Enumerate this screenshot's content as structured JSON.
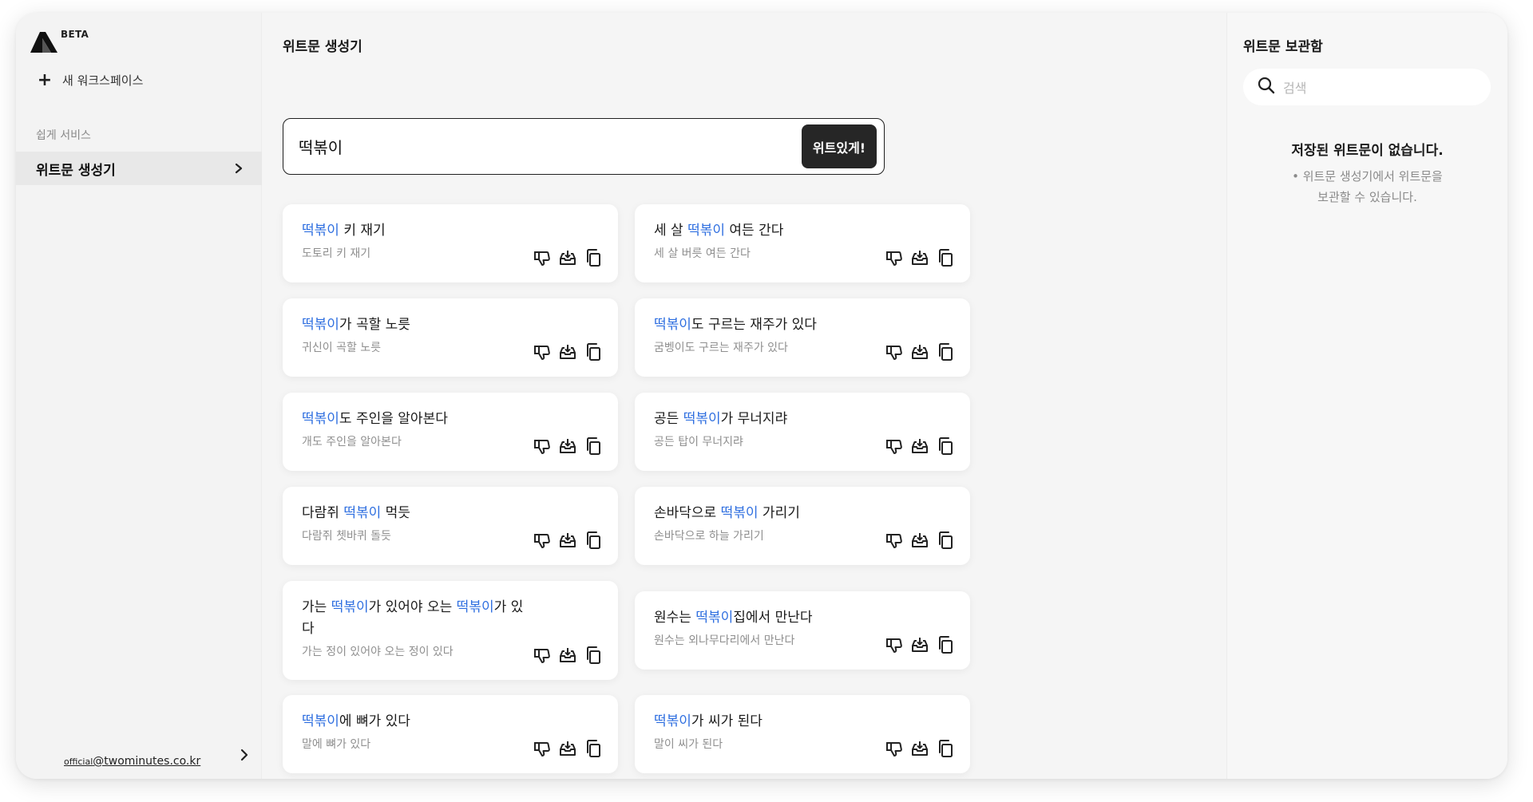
{
  "sidebar": {
    "beta_badge": "BETA",
    "new_workspace": "새 워크스페이스",
    "section_title": "쉽게 서비스",
    "nav_active": "위트문 생성기",
    "email_prefix": "official",
    "email_domain": "@twominutes.co.kr"
  },
  "main": {
    "title": "위트문 생성기",
    "input_value": "떡볶이",
    "generate_button": "위트있게!",
    "cards": [
      {
        "pre": "",
        "hl": "떡볶이",
        "post": " 키 재기",
        "hl2": "",
        "post2": "",
        "orig": "도토리 키 재기"
      },
      {
        "pre": "세 살 ",
        "hl": "떡볶이",
        "post": " 여든 간다",
        "hl2": "",
        "post2": "",
        "orig": "세 살 버릇 여든 간다"
      },
      {
        "pre": "",
        "hl": "떡볶이",
        "post": "가 곡할 노릇",
        "hl2": "",
        "post2": "",
        "orig": "귀신이 곡할 노릇"
      },
      {
        "pre": "",
        "hl": "떡볶이",
        "post": "도 구르는 재주가 있다",
        "hl2": "",
        "post2": "",
        "orig": "굼벵이도 구르는 재주가 있다"
      },
      {
        "pre": "",
        "hl": "떡볶이",
        "post": "도 주인을 알아본다",
        "hl2": "",
        "post2": "",
        "orig": "개도 주인을 알아본다"
      },
      {
        "pre": "공든 ",
        "hl": "떡볶이",
        "post": "가 무너지랴",
        "hl2": "",
        "post2": "",
        "orig": "공든 탑이 무너지랴"
      },
      {
        "pre": "다람쥐 ",
        "hl": "떡볶이",
        "post": " 먹듯",
        "hl2": "",
        "post2": "",
        "orig": "다람쥐 쳇바퀴 돌듯"
      },
      {
        "pre": "손바닥으로 ",
        "hl": "떡볶이",
        "post": " 가리기",
        "hl2": "",
        "post2": "",
        "orig": "손바닥으로 하늘 가리기"
      },
      {
        "pre": "가는 ",
        "hl": "떡볶이",
        "post": "가 있어야 오는 ",
        "hl2": "떡볶이",
        "post2": "가 있다",
        "orig": "가는 정이 있어야 오는 정이 있다"
      },
      {
        "pre": "원수는 ",
        "hl": "떡볶이",
        "post": "집에서 만난다",
        "hl2": "",
        "post2": "",
        "orig": "원수는 외나무다리에서 만난다"
      },
      {
        "pre": "",
        "hl": "떡볶이",
        "post": "에 뼈가 있다",
        "hl2": "",
        "post2": "",
        "orig": "말에 뼈가 있다"
      },
      {
        "pre": "",
        "hl": "떡볶이",
        "post": "가 씨가 된다",
        "hl2": "",
        "post2": "",
        "orig": "말이 씨가 된다"
      }
    ]
  },
  "rpanel": {
    "title": "위트문 보관함",
    "search_placeholder": "검색",
    "empty_title": "저장된 위트문이 없습니다.",
    "hint_line1": "• 위트문 생성기에서 위트문을",
    "hint_line2": "보관할 수 있습니다."
  },
  "icons": {
    "logo": "logo-icon",
    "plus": "plus-icon",
    "chevron": "chevron-right-icon",
    "search": "search-icon",
    "dislike": "thumbs-down-icon",
    "save": "download-icon",
    "copy": "copy-icon"
  },
  "colors": {
    "highlight": "#2f6fe0",
    "button_bg": "#262626"
  }
}
